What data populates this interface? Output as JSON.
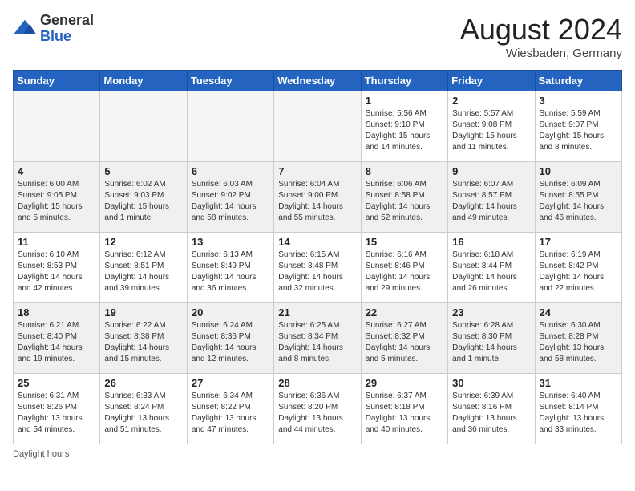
{
  "logo": {
    "general": "General",
    "blue": "Blue"
  },
  "title": "August 2024",
  "location": "Wiesbaden, Germany",
  "days_of_week": [
    "Sunday",
    "Monday",
    "Tuesday",
    "Wednesday",
    "Thursday",
    "Friday",
    "Saturday"
  ],
  "weeks": [
    [
      {
        "day": "",
        "empty": true
      },
      {
        "day": "",
        "empty": true
      },
      {
        "day": "",
        "empty": true
      },
      {
        "day": "",
        "empty": true
      },
      {
        "day": "1",
        "rise": "5:56 AM",
        "set": "9:10 PM",
        "daylight": "15 hours and 14 minutes."
      },
      {
        "day": "2",
        "rise": "5:57 AM",
        "set": "9:08 PM",
        "daylight": "15 hours and 11 minutes."
      },
      {
        "day": "3",
        "rise": "5:59 AM",
        "set": "9:07 PM",
        "daylight": "15 hours and 8 minutes."
      }
    ],
    [
      {
        "day": "4",
        "rise": "6:00 AM",
        "set": "9:05 PM",
        "daylight": "15 hours and 5 minutes."
      },
      {
        "day": "5",
        "rise": "6:02 AM",
        "set": "9:03 PM",
        "daylight": "15 hours and 1 minute."
      },
      {
        "day": "6",
        "rise": "6:03 AM",
        "set": "9:02 PM",
        "daylight": "14 hours and 58 minutes."
      },
      {
        "day": "7",
        "rise": "6:04 AM",
        "set": "9:00 PM",
        "daylight": "14 hours and 55 minutes."
      },
      {
        "day": "8",
        "rise": "6:06 AM",
        "set": "8:58 PM",
        "daylight": "14 hours and 52 minutes."
      },
      {
        "day": "9",
        "rise": "6:07 AM",
        "set": "8:57 PM",
        "daylight": "14 hours and 49 minutes."
      },
      {
        "day": "10",
        "rise": "6:09 AM",
        "set": "8:55 PM",
        "daylight": "14 hours and 46 minutes."
      }
    ],
    [
      {
        "day": "11",
        "rise": "6:10 AM",
        "set": "8:53 PM",
        "daylight": "14 hours and 42 minutes."
      },
      {
        "day": "12",
        "rise": "6:12 AM",
        "set": "8:51 PM",
        "daylight": "14 hours and 39 minutes."
      },
      {
        "day": "13",
        "rise": "6:13 AM",
        "set": "8:49 PM",
        "daylight": "14 hours and 36 minutes."
      },
      {
        "day": "14",
        "rise": "6:15 AM",
        "set": "8:48 PM",
        "daylight": "14 hours and 32 minutes."
      },
      {
        "day": "15",
        "rise": "6:16 AM",
        "set": "8:46 PM",
        "daylight": "14 hours and 29 minutes."
      },
      {
        "day": "16",
        "rise": "6:18 AM",
        "set": "8:44 PM",
        "daylight": "14 hours and 26 minutes."
      },
      {
        "day": "17",
        "rise": "6:19 AM",
        "set": "8:42 PM",
        "daylight": "14 hours and 22 minutes."
      }
    ],
    [
      {
        "day": "18",
        "rise": "6:21 AM",
        "set": "8:40 PM",
        "daylight": "14 hours and 19 minutes."
      },
      {
        "day": "19",
        "rise": "6:22 AM",
        "set": "8:38 PM",
        "daylight": "14 hours and 15 minutes."
      },
      {
        "day": "20",
        "rise": "6:24 AM",
        "set": "8:36 PM",
        "daylight": "14 hours and 12 minutes."
      },
      {
        "day": "21",
        "rise": "6:25 AM",
        "set": "8:34 PM",
        "daylight": "14 hours and 8 minutes."
      },
      {
        "day": "22",
        "rise": "6:27 AM",
        "set": "8:32 PM",
        "daylight": "14 hours and 5 minutes."
      },
      {
        "day": "23",
        "rise": "6:28 AM",
        "set": "8:30 PM",
        "daylight": "14 hours and 1 minute."
      },
      {
        "day": "24",
        "rise": "6:30 AM",
        "set": "8:28 PM",
        "daylight": "13 hours and 58 minutes."
      }
    ],
    [
      {
        "day": "25",
        "rise": "6:31 AM",
        "set": "8:26 PM",
        "daylight": "13 hours and 54 minutes."
      },
      {
        "day": "26",
        "rise": "6:33 AM",
        "set": "8:24 PM",
        "daylight": "13 hours and 51 minutes."
      },
      {
        "day": "27",
        "rise": "6:34 AM",
        "set": "8:22 PM",
        "daylight": "13 hours and 47 minutes."
      },
      {
        "day": "28",
        "rise": "6:36 AM",
        "set": "8:20 PM",
        "daylight": "13 hours and 44 minutes."
      },
      {
        "day": "29",
        "rise": "6:37 AM",
        "set": "8:18 PM",
        "daylight": "13 hours and 40 minutes."
      },
      {
        "day": "30",
        "rise": "6:39 AM",
        "set": "8:16 PM",
        "daylight": "13 hours and 36 minutes."
      },
      {
        "day": "31",
        "rise": "6:40 AM",
        "set": "8:14 PM",
        "daylight": "13 hours and 33 minutes."
      }
    ]
  ],
  "footer": "Daylight hours"
}
